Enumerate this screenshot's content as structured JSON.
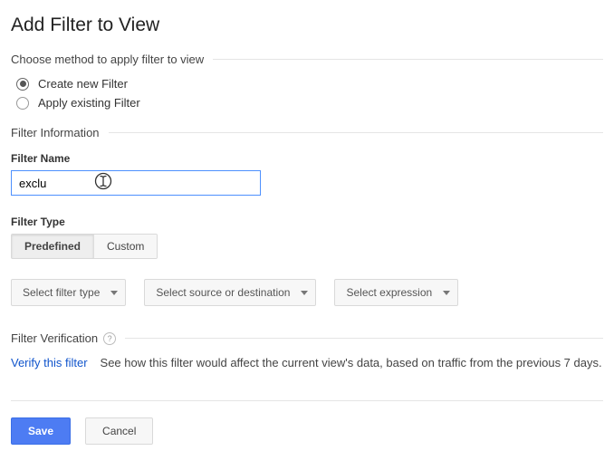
{
  "page": {
    "title": "Add Filter to View"
  },
  "method": {
    "header": "Choose method to apply filter to view",
    "options": {
      "create": "Create new Filter",
      "existing": "Apply existing Filter"
    },
    "selected": "create"
  },
  "filter_info": {
    "header": "Filter Information",
    "name_label": "Filter Name",
    "name_value": "exclu",
    "type_label": "Filter Type",
    "type_toggle": {
      "predefined": "Predefined",
      "custom": "Custom"
    },
    "dropdowns": {
      "filter_type": "Select filter type",
      "source_dest": "Select source or destination",
      "expression": "Select expression"
    }
  },
  "verification": {
    "header": "Filter Verification",
    "link": "Verify this filter",
    "desc": "See how this filter would affect the current view's data, based on traffic from the previous 7 days."
  },
  "footer": {
    "save": "Save",
    "cancel": "Cancel"
  }
}
